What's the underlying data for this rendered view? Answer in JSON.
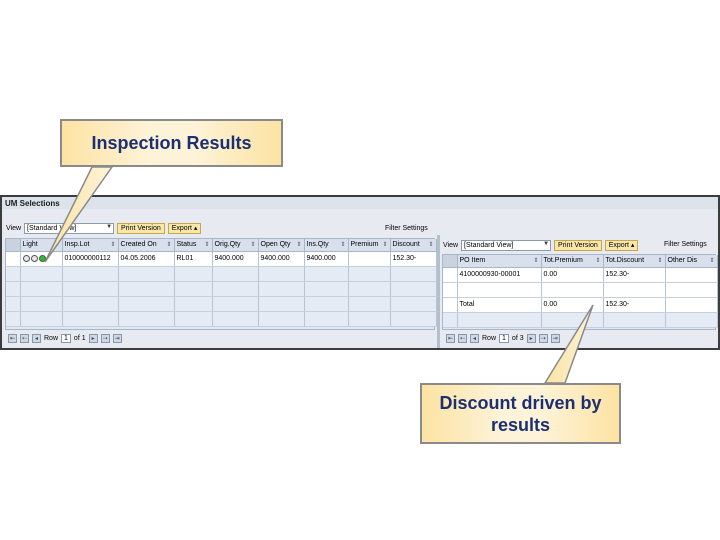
{
  "callouts": {
    "top": "Inspection Results",
    "bottom": "Discount driven by results"
  },
  "window": {
    "title": "UM Selections"
  },
  "left_panel": {
    "view_label": "View",
    "view_value": "[Standard View]",
    "print_button": "Print Version",
    "export_button": "Export",
    "filter_link": "Filter Settings",
    "columns": [
      "Light",
      "Insp.Lot",
      "Created On",
      "Status",
      "Orig.Qty",
      "Open Qty",
      "Ins.Qty",
      "Premium",
      "Discount"
    ],
    "rows": [
      {
        "light": "green",
        "insp_lot": "010000000112",
        "created_on": "04.05.2006",
        "status": "RL01",
        "orig_qty": "9400.000",
        "open_qty": "9400.000",
        "ins_qty": "9400.000",
        "premium": "",
        "discount": "152.30-"
      }
    ],
    "empty_rows": 4,
    "footer": {
      "row_label": "Row",
      "row_value": "1",
      "of_label": "of 1"
    }
  },
  "right_panel": {
    "view_label": "View",
    "view_value": "[Standard View]",
    "print_button": "Print Version",
    "export_button": "Export",
    "filter_link": "Filter Settings",
    "columns": [
      "PO Item",
      "Tot.Premium",
      "Tot.Discount",
      "Other Dis"
    ],
    "rows": [
      {
        "po_item": "4100000930-00001",
        "premium": "0.00",
        "discount": "152.30-",
        "other": ""
      },
      {
        "po_item": "",
        "premium": "",
        "discount": "",
        "other": ""
      },
      {
        "po_item": "Total",
        "premium": "0.00",
        "discount": "152.30-",
        "other": ""
      }
    ],
    "empty_rows": 1,
    "footer": {
      "row_label": "Row",
      "row_value": "1",
      "of_label": "of 3"
    }
  },
  "colors": {
    "callout_text": "#1c2f73",
    "button_bg": "#f8e7a8",
    "grid_bg": "#dfe7f2",
    "light_on": "#27c427"
  }
}
